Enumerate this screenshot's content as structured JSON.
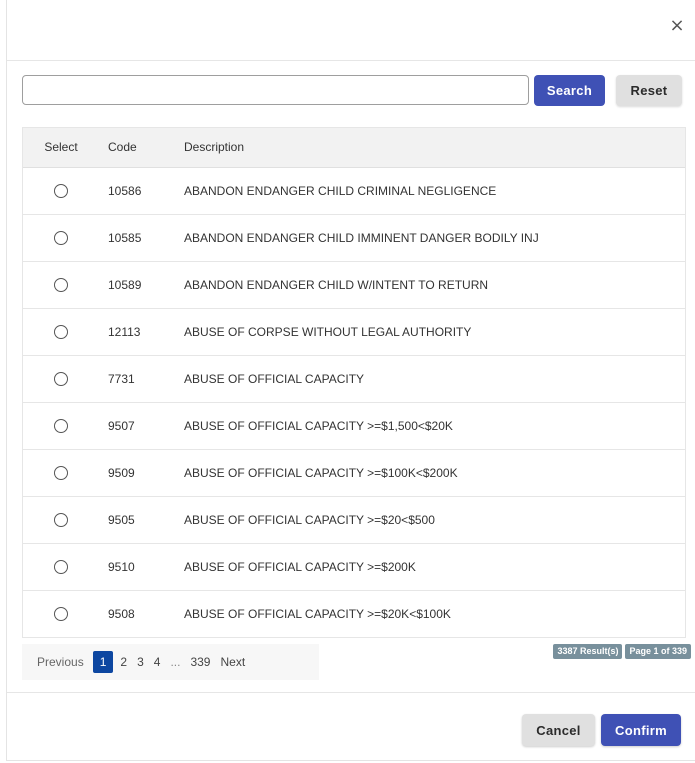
{
  "dialog": {
    "close_glyph": "×"
  },
  "search": {
    "value": "",
    "placeholder": "",
    "search_label": "Search",
    "reset_label": "Reset"
  },
  "table": {
    "headers": {
      "select": "Select",
      "code": "Code",
      "description": "Description"
    },
    "rows": [
      {
        "code": "10586",
        "description": "ABANDON ENDANGER CHILD CRIMINAL NEGLIGENCE"
      },
      {
        "code": "10585",
        "description": "ABANDON ENDANGER CHILD IMMINENT DANGER BODILY INJ"
      },
      {
        "code": "10589",
        "description": "ABANDON ENDANGER CHILD W/INTENT TO RETURN"
      },
      {
        "code": "12113",
        "description": "ABUSE OF CORPSE WITHOUT LEGAL AUTHORITY"
      },
      {
        "code": "7731",
        "description": "ABUSE OF OFFICIAL CAPACITY"
      },
      {
        "code": "9507",
        "description": "ABUSE OF OFFICIAL CAPACITY >=$1,500<$20K"
      },
      {
        "code": "9509",
        "description": "ABUSE OF OFFICIAL CAPACITY >=$100K<$200K"
      },
      {
        "code": "9505",
        "description": "ABUSE OF OFFICIAL CAPACITY >=$20<$500"
      },
      {
        "code": "9510",
        "description": "ABUSE OF OFFICIAL CAPACITY >=$200K"
      },
      {
        "code": "9508",
        "description": "ABUSE OF OFFICIAL CAPACITY >=$20K<$100K"
      }
    ]
  },
  "pagination": {
    "previous": "Previous",
    "pages": [
      "1",
      "2",
      "3",
      "4"
    ],
    "ellipsis": "...",
    "last": "339",
    "next": "Next",
    "current": "1",
    "results_badge": "3387 Result(s)",
    "page_badge": "Page 1 of 339"
  },
  "footer": {
    "cancel_label": "Cancel",
    "confirm_label": "Confirm"
  },
  "colors": {
    "primary": "#3f51b5",
    "pager_active": "#0d47a1",
    "badge": "#78909c",
    "neutral_button": "#e0e0e0"
  }
}
